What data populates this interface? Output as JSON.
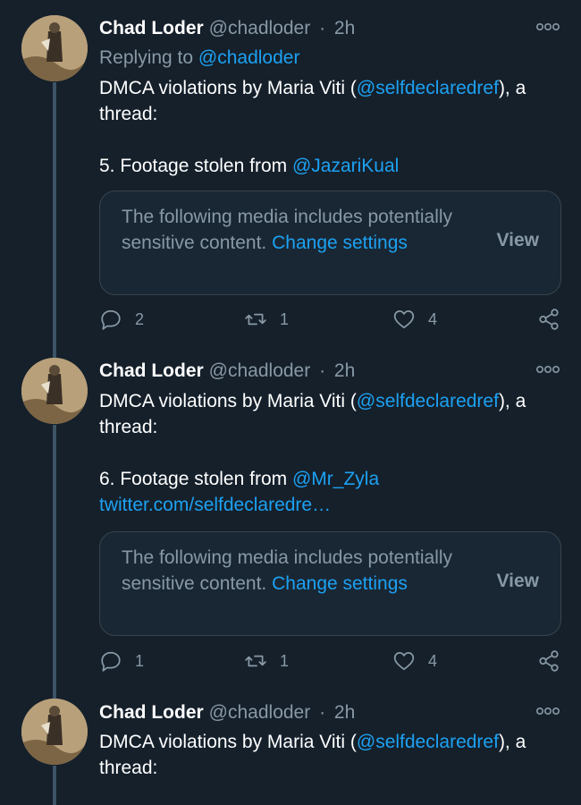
{
  "tweets": [
    {
      "name": "Chad Loder",
      "handle": "@chadloder",
      "time": "2h",
      "replying_prefix": "Replying to",
      "replying_to": "@chadloder",
      "text_pre": "DMCA violations by Maria Viti (",
      "text_mention": "@selfdeclaredref",
      "text_post": "), a thread:",
      "line2_pre": "5. Footage stolen from",
      "line2_mention": "@JazariKual",
      "line3_link": "",
      "sensitive_text": "The following media includes potentially sensitive content.",
      "change_settings": "Change settings",
      "view_label": "View",
      "replies": "2",
      "retweets": "1",
      "likes": "4"
    },
    {
      "name": "Chad Loder",
      "handle": "@chadloder",
      "time": "2h",
      "text_pre": "DMCA violations by Maria Viti (",
      "text_mention": "@selfdeclaredref",
      "text_post": "), a thread:",
      "line2_pre": "6. Footage stolen from",
      "line2_mention": "@Mr_Zyla",
      "line3_link": "twitter.com/selfdeclaredre…",
      "sensitive_text": "The following media includes potentially sensitive content.",
      "change_settings": "Change settings",
      "view_label": "View",
      "replies": "1",
      "retweets": "1",
      "likes": "4"
    },
    {
      "name": "Chad Loder",
      "handle": "@chadloder",
      "time": "2h",
      "text_pre": "DMCA violations by Maria Viti (",
      "text_mention": "@selfdeclaredref",
      "text_post": "), a thread:"
    }
  ],
  "separator": "·",
  "icons": {
    "more": "more-horizontal-icon",
    "reply": "reply-icon",
    "retweet": "retweet-icon",
    "like": "heart-icon",
    "share": "share-icon"
  },
  "colors": {
    "background": "#15202b",
    "link": "#1da1f2",
    "muted": "#8899a6",
    "thread_line": "#3d5466"
  }
}
